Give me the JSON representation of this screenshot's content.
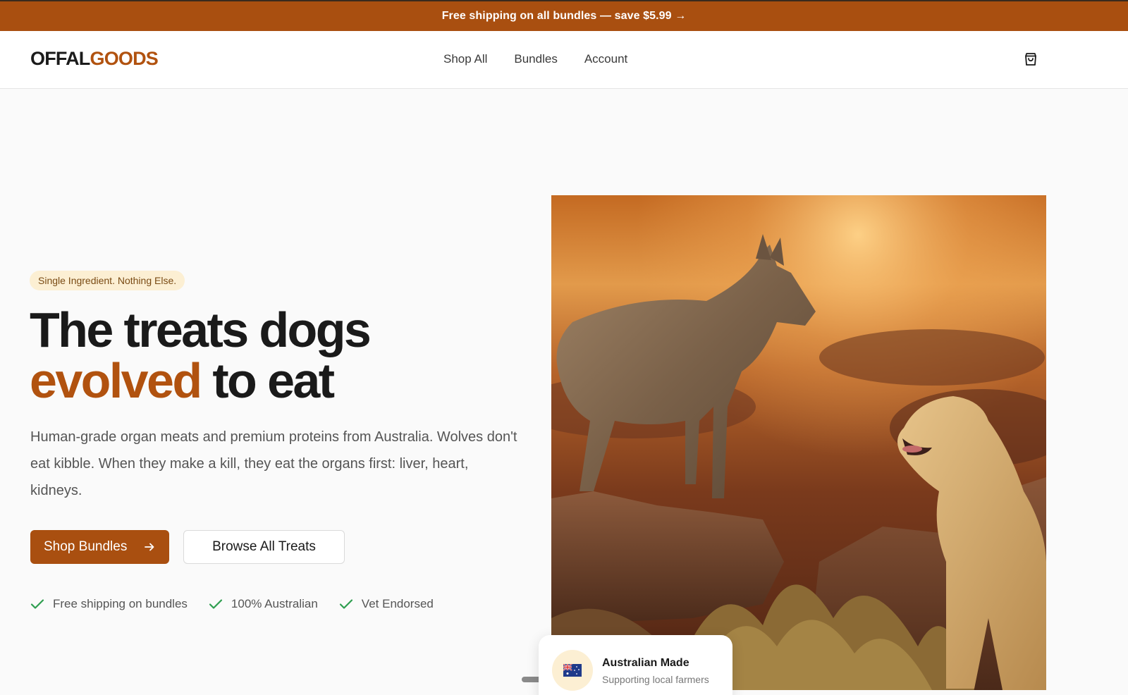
{
  "announcement": {
    "text": "Free shipping on all bundles — save $5.99 →"
  },
  "brand": {
    "part1": "OFFAL",
    "part2": "GOODS"
  },
  "nav": {
    "items": [
      "Shop All",
      "Bundles",
      "Account"
    ]
  },
  "hero": {
    "eyebrow": "Single Ingredient. Nothing Else.",
    "headline_line1": "The treats dogs",
    "headline_accent": "evolved",
    "headline_rest": " to eat",
    "lead": "Human-grade organ meats and premium proteins from Australia. Wolves don't eat kibble. When they make a kill, they eat the organs first: liver, heart, kidneys.",
    "primary_cta": "Shop Bundles",
    "secondary_cta": "Browse All Treats",
    "trust": [
      "Free shipping on bundles",
      "100% Australian",
      "Vet Endorsed"
    ]
  },
  "badge": {
    "title": "Australian Made",
    "subtitle": "Supporting local farmers"
  },
  "icons": {
    "cart": "shopping-bag-icon",
    "arrow": "arrow-right-icon",
    "check": "check-icon",
    "flag": "australia-flag-icon"
  },
  "colors": {
    "brand": "#a94f10",
    "accent_text": "#b1520f",
    "check": "#2e9e4f",
    "eyebrow_bg": "#fcefd3"
  }
}
